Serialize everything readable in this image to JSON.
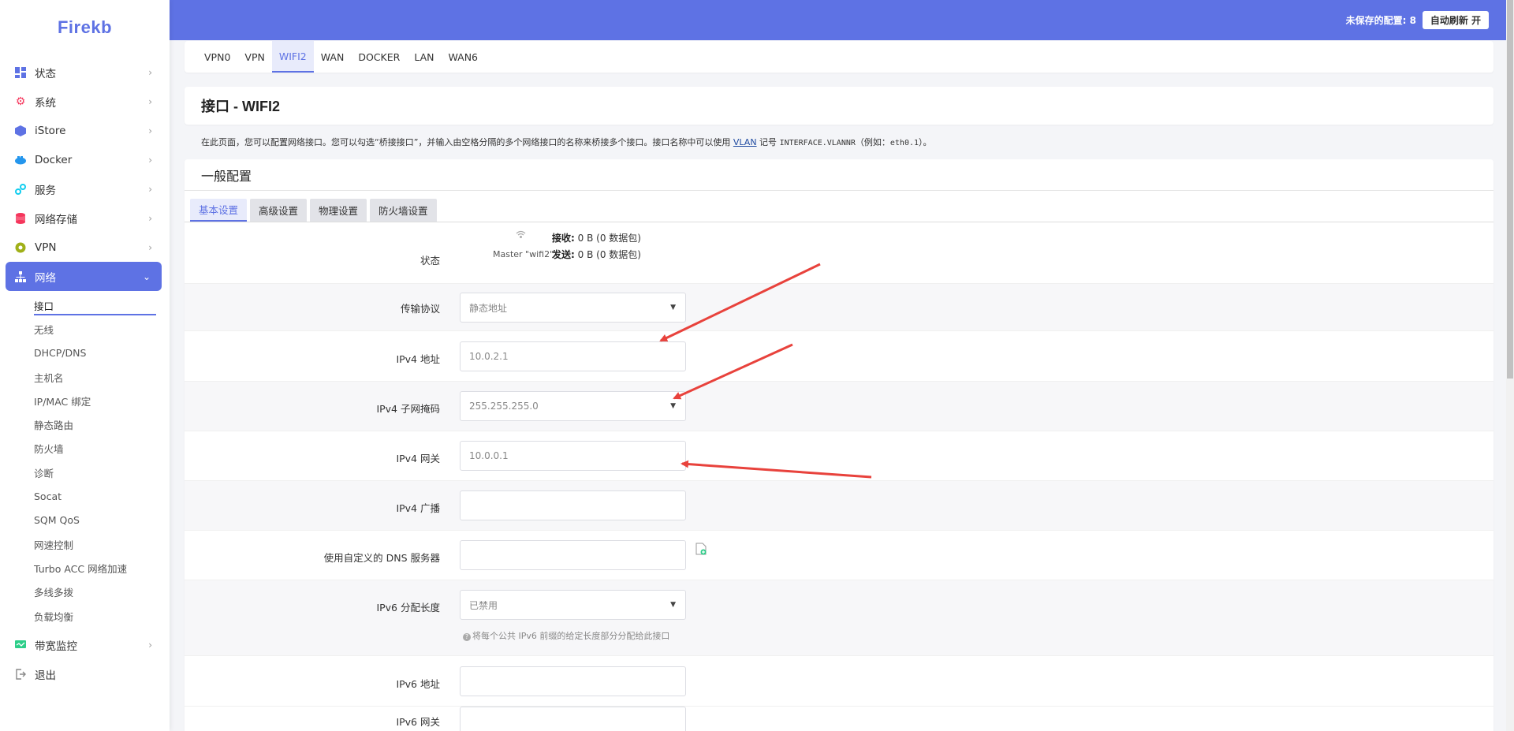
{
  "app": {
    "logo": "Firekb"
  },
  "sidebar": {
    "items": [
      {
        "label": "状态",
        "icon": "dashboard-icon",
        "color": "#5e72e4"
      },
      {
        "label": "系统",
        "icon": "gear-icon",
        "color": "#f5365c"
      },
      {
        "label": "iStore",
        "icon": "cube-icon",
        "color": "#5e72e4"
      },
      {
        "label": "Docker",
        "icon": "docker-icon",
        "color": "#2496ed"
      },
      {
        "label": "服务",
        "icon": "services-icon",
        "color": "#11cdef"
      },
      {
        "label": "网络存储",
        "icon": "database-icon",
        "color": "#f5365c"
      },
      {
        "label": "VPN",
        "icon": "vpn-icon",
        "color": "#a0b018"
      },
      {
        "label": "网络",
        "icon": "network-icon",
        "color": "#ffffff"
      },
      {
        "label": "带宽监控",
        "icon": "monitor-icon",
        "color": "#2dce89"
      },
      {
        "label": "退出",
        "icon": "logout-icon",
        "color": "#888888"
      }
    ],
    "network_sub": [
      "接口",
      "无线",
      "DHCP/DNS",
      "主机名",
      "IP/MAC 绑定",
      "静态路由",
      "防火墙",
      "诊断",
      "Socat",
      "SQM QoS",
      "网速控制",
      "Turbo ACC 网络加速",
      "多线多拨",
      "负载均衡"
    ]
  },
  "topbar": {
    "unsaved": "未保存的配置: 8",
    "auto_refresh": "自动刷新 开",
    "accent": "#5e72e4"
  },
  "tabs": [
    "VPN0",
    "VPN",
    "WIFI2",
    "WAN",
    "DOCKER",
    "LAN",
    "WAN6"
  ],
  "active_tab": "WIFI2",
  "page": {
    "title": "接口 - WIFI2",
    "desc_pre": "在此页面，您可以配置网络接口。您可以勾选“桥接接口”，并输入由空格分隔的多个网络接口的名称来桥接多个接口。接口名称中可以使用 ",
    "desc_link": "VLAN",
    "desc_mid": " 记号 ",
    "desc_code": "INTERFACE.VLANNR",
    "desc_example": "（例如：",
    "desc_code2": "eth0.1",
    "desc_post": "）。"
  },
  "section": {
    "title": "一般配置",
    "subtabs": [
      "基本设置",
      "高级设置",
      "物理设置",
      "防火墙设置"
    ]
  },
  "form": {
    "status": {
      "label": "状态",
      "device": "Master \"wifi2\"",
      "rx_label": "接收:",
      "rx_value": "0 B (0 数据包)",
      "tx_label": "发送:",
      "tx_value": "0 B (0 数据包)"
    },
    "protocol": {
      "label": "传输协议",
      "value": "静态地址"
    },
    "ipv4_addr": {
      "label": "IPv4 地址",
      "value": "10.0.2.1"
    },
    "ipv4_mask": {
      "label": "IPv4 子网掩码",
      "value": "255.255.255.0"
    },
    "ipv4_gw": {
      "label": "IPv4 网关",
      "value": "10.0.0.1"
    },
    "ipv4_bcast": {
      "label": "IPv4 广播",
      "value": ""
    },
    "dns": {
      "label": "使用自定义的 DNS 服务器",
      "value": ""
    },
    "ipv6_assign": {
      "label": "IPv6 分配长度",
      "value": "已禁用",
      "hint": "将每个公共 IPv6 前缀的给定长度部分分配给此接口"
    },
    "ipv6_addr": {
      "label": "IPv6 地址",
      "value": ""
    },
    "ipv6_gw": {
      "label": "IPv6 网关",
      "value": ""
    }
  },
  "annotation_color": "#e8423c"
}
